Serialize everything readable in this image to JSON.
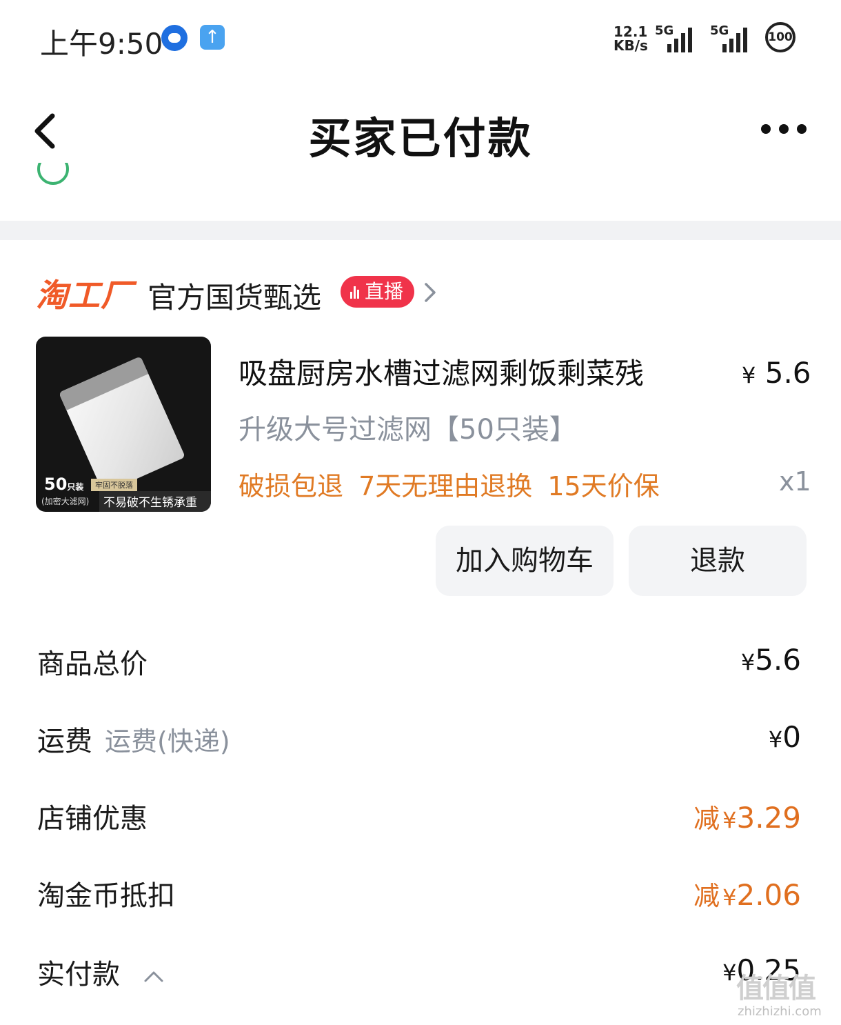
{
  "status_bar": {
    "time": "上午9:50",
    "upload_icon": "↑",
    "net_speed_top": "12.1",
    "net_speed_bottom": "KB/s",
    "signal1": "5G",
    "signal2": "5G",
    "battery": "100"
  },
  "nav": {
    "title": "买家已付款",
    "back_icon": "chevron-left-icon",
    "more_icon": "more-dots-icon"
  },
  "shop": {
    "logo": "淘工厂",
    "name": "官方国货甄选",
    "live_badge": "直播"
  },
  "product": {
    "title": "吸盘厨房水槽过滤网剩饭剩菜残",
    "price_symbol": "¥",
    "price": "5.6",
    "spec": "升级大号过滤网【50只装】",
    "services": "破损包退 7天无理由退换 15天价保",
    "quantity": "x1",
    "image": {
      "count": "50",
      "count_unit": "只装",
      "sub": "(加密大滤网)",
      "tag": "牢固不脱落",
      "slogan": "不易破不生锈承重强"
    }
  },
  "actions": {
    "add_to_cart": "加入购物车",
    "refund": "退款"
  },
  "summary": {
    "total_label": "商品总价",
    "total_symbol": "¥",
    "total_value": "5.6",
    "shipping_label": "运费",
    "shipping_sub": "运费(快递)",
    "shipping_symbol": "¥",
    "shipping_value": "0",
    "shop_discount_label": "店铺优惠",
    "shop_discount_prefix": "减",
    "shop_discount_symbol": "¥",
    "shop_discount_value": "3.29",
    "coin_label": "淘金币抵扣",
    "coin_prefix": "减",
    "coin_symbol": "¥",
    "coin_value": "2.06",
    "paid_label": "实付款",
    "paid_symbol": "¥",
    "paid_value": "0.25"
  },
  "watermark": {
    "logo": "值值值",
    "url": "zhizhizhi.com"
  },
  "colors": {
    "accent_orange": "#e06f1f",
    "live_red": "#f0334a",
    "muted_gray": "#8a919c",
    "button_bg": "#f3f4f6"
  }
}
